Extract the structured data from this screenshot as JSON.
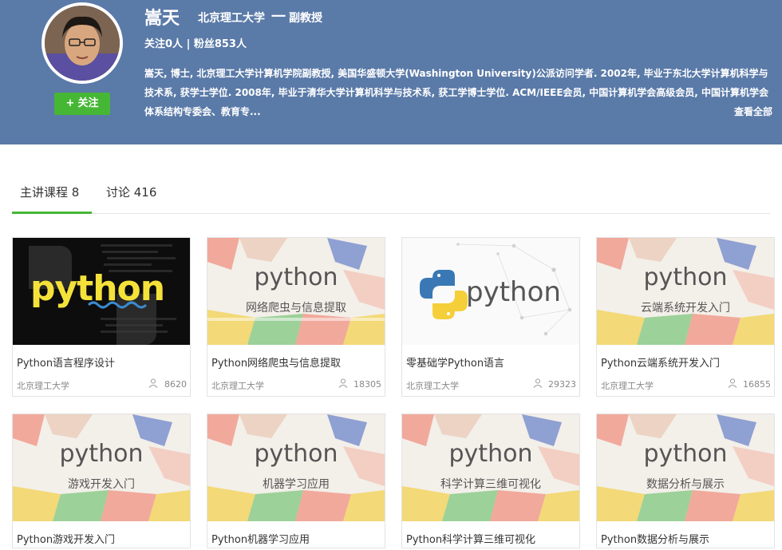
{
  "profile": {
    "name": "嵩天",
    "school": "北京理工大学",
    "separator": "一",
    "title": "副教授",
    "stats": "关注0人 | 粉丝853人",
    "bio": "嵩天, 博士, 北京理工大学计算机学院副教授, 美国华盛顿大学(Washington University)公派访问学者. 2002年, 毕业于东北大学计算机科学与技术系, 获学士学位. 2008年, 毕业于清华大学计算机科学与技术系, 获工学博士学位. ACM/IEEE会员, 中国计算机学会高级会员, 中国计算机学会体系结构专委会、教育专...",
    "view_all": "查看全部",
    "follow_plus": "+",
    "follow_label": "关注"
  },
  "tabs": [
    {
      "label": "主讲课程 8"
    },
    {
      "label": "讨论 416"
    }
  ],
  "courses": [
    {
      "title": "Python语言程序设计",
      "school": "北京理工大学",
      "count": "8620",
      "thumb_word": "python",
      "thumb_sub": ""
    },
    {
      "title": "Python网络爬虫与信息提取",
      "school": "北京理工大学",
      "count": "18305",
      "thumb_word": "python",
      "thumb_sub": "网络爬虫与信息提取"
    },
    {
      "title": "零基础学Python语言",
      "school": "北京理工大学",
      "count": "29323",
      "thumb_word": "python",
      "thumb_sub": ""
    },
    {
      "title": "Python云端系统开发入门",
      "school": "北京理工大学",
      "count": "16855",
      "thumb_word": "python",
      "thumb_sub": "云端系统开发入门"
    },
    {
      "title": "Python游戏开发入门",
      "school": "",
      "count": "",
      "thumb_word": "python",
      "thumb_sub": "游戏开发入门"
    },
    {
      "title": "Python机器学习应用",
      "school": "",
      "count": "",
      "thumb_word": "python",
      "thumb_sub": "机器学习应用"
    },
    {
      "title": "Python科学计算三维可视化",
      "school": "",
      "count": "",
      "thumb_word": "python",
      "thumb_sub": "科学计算三维可视化"
    },
    {
      "title": "Python数据分析与展示",
      "school": "",
      "count": "",
      "thumb_word": "python",
      "thumb_sub": "数据分析与展示"
    }
  ],
  "colors": {
    "header_bg": "#5a7aa8",
    "accent_green": "#46b735",
    "python_yellow": "#f7e83a",
    "python_blue": "#3a78b5"
  }
}
